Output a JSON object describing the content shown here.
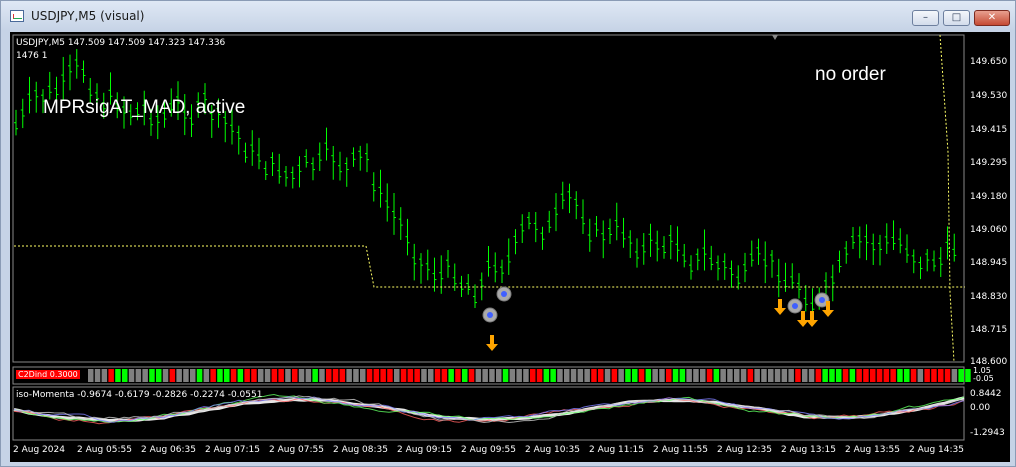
{
  "window": {
    "title": "USDJPY,M5 (visual)",
    "buttons": {
      "minimize": "–",
      "maximize": "□",
      "close": "✕"
    }
  },
  "chart": {
    "symbol_line": "USDJPY,M5  147.509 147.509 147.323 147.336",
    "bars_line": "1476  1",
    "ea_label": "MPRsigAT_MAD, active",
    "order_status": "no order",
    "y_axis_labels": [
      "149.650",
      "149.530",
      "149.415",
      "149.295",
      "149.180",
      "149.060",
      "148.945",
      "148.830",
      "148.715",
      "148.600"
    ],
    "x_axis_labels": [
      "2 Aug 2024",
      "2 Aug 05:55",
      "2 Aug 06:35",
      "2 Aug 07:15",
      "2 Aug 07:55",
      "2 Aug 08:35",
      "2 Aug 09:15",
      "2 Aug 09:55",
      "2 Aug 10:35",
      "2 Aug 11:15",
      "2 Aug 11:55",
      "2 Aug 12:35",
      "2 Aug 13:15",
      "2 Aug 13:55",
      "2 Aug 14:35"
    ]
  },
  "c2d_panel": {
    "label": "C2Dind 0.3000",
    "axis_top": "1.05",
    "axis_bottom": "-0.05"
  },
  "momentum_panel": {
    "label": "iso-Momenta -0.9674 -0.6179 -0.2826 -0.2274 -0.0551",
    "axis_labels": [
      "0.8442",
      "0.00",
      "-1.2943"
    ]
  },
  "colors": {
    "background": "#000000",
    "bars": "#00ff00",
    "sell_arrow": "#ffa500",
    "c2d_red": "#ff0000",
    "c2d_green": "#00ff00",
    "c2d_gray": "#808080",
    "level_line": "#ffff66"
  }
}
